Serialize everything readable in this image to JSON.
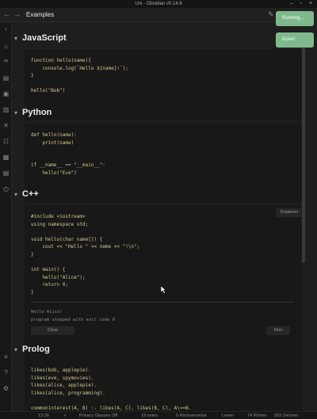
{
  "window": {
    "title": "Uni - Obsidian v0.14.8"
  },
  "tab": {
    "name": "Examples",
    "edit_glyph": "✎"
  },
  "toasts": [
    "Running...",
    "Done!"
  ],
  "sections": {
    "js": {
      "heading": "JavaScript",
      "code": "function hello(name){\n    console.log(`Hello ${name}!`);\n}\n\nhello(\"Bob\")"
    },
    "py": {
      "heading": "Python",
      "code": "def hello(name):\n    print(name)\n\n\nif __name__ == \"__main__\":\n    hello(\"Eve\")"
    },
    "cpp": {
      "heading": "C++",
      "copy_label": "Kopieren",
      "code": "#include <iostream>\nusing namespace std;\n\nvoid hello(char name[]) {\n    cout << \"Hello \" << name << \"!\\n\";\n}\n\nint main() {\n    hello(\"Alice\");\n    return 0;\n}",
      "output": "Hello Alice!\nprogram stopped with exit code 0",
      "clear_label": "Clear",
      "run_label": "Run"
    },
    "prolog": {
      "heading": "Prolog",
      "code": "likes(bob, applepie).\nlikes(eve, spymovies).\nlikes(alice, applepie).\nlikes(alice, programming).\n\ncommoninterest(A, B) :- likes(A, C), likes(B, C), A\\==B."
    }
  },
  "status": {
    "time": "13:36",
    "check": "✓",
    "privacy": "Privacy Glasses Off",
    "notes": "19 notes",
    "backlinks": "0 Rückverweise",
    "mode": "Lesen",
    "words": "74 Wörter",
    "chars": "592 Zeichen"
  },
  "icons": {
    "chevron": "▾",
    "nav_back": "←",
    "nav_forward": "→",
    "ribbon": [
      "›",
      "⌂",
      "∞",
      "▤",
      "▣",
      "▥",
      "✕",
      "☷",
      "▦",
      "▤",
      "◴",
      "≡",
      "?",
      "⚙"
    ]
  }
}
